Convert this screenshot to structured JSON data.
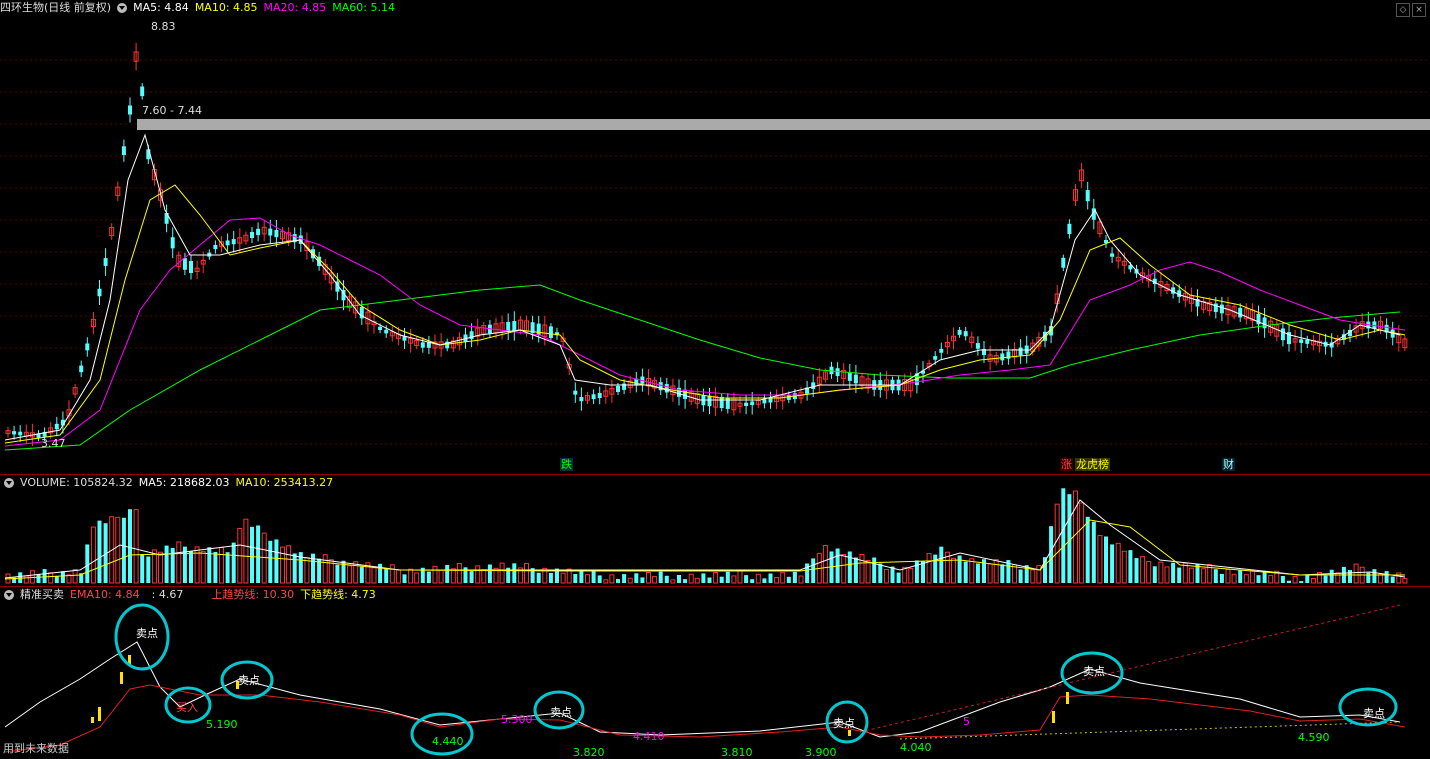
{
  "main": {
    "title": "四环生物(日线 前复权)",
    "ma5": "MA5: 4.84",
    "ma10": "MA10: 4.85",
    "ma20": "MA20: 4.85",
    "ma60": "MA60: 5.14",
    "high_label": "8.83",
    "band_label": "7.60 - 7.44",
    "low_label": "3.47",
    "tags": {
      "die": "跌",
      "zhang": "涨",
      "bang": "龙虎榜",
      "cai": "财"
    }
  },
  "volume": {
    "label": "VOLUME: 105824.32",
    "ma5": "MA5: 218682.03",
    "ma10": "MA10: 253413.27"
  },
  "indicator": {
    "name": "精准买卖",
    "ema10": "EMA10: 4.84",
    "val": ": 4.67",
    "upper": "上趋势线: 10.30",
    "lower": "下趋势线: 4.73",
    "sell_label": "卖点",
    "buy_label": "买入",
    "labels": [
      "5.190",
      "4.440",
      "5.300",
      "3.820",
      "4.410",
      "3.810",
      "3.900",
      "4.040",
      "4.590",
      "5"
    ],
    "footer": "用到未来数据"
  },
  "colors": {
    "up": "#ff3232",
    "down": "#54ffff",
    "ma5": "#ffffff",
    "ma10": "#ffff00",
    "ma20": "#ff00ff",
    "ma60": "#00ff00",
    "circle": "#00c8d0"
  }
}
